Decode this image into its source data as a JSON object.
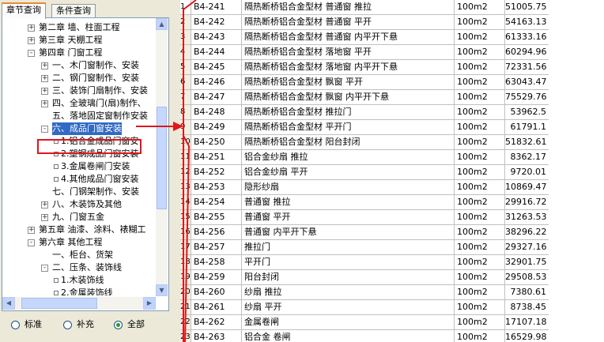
{
  "tabs": [
    {
      "label": "章节查询",
      "active": true
    },
    {
      "label": "条件查询",
      "active": false
    }
  ],
  "tree": [
    {
      "label": "第二章 墙、柱面工程",
      "expander": "+"
    },
    {
      "label": "第三章 天棚工程",
      "expander": "+"
    },
    {
      "label": "第四章 门窗工程",
      "expander": "-"
    },
    {
      "label": "一、木门窗制作、安装",
      "expander": "+"
    },
    {
      "label": "二、钢门窗制作、安装",
      "expander": "+"
    },
    {
      "label": "三、装饰门扇制作、安装",
      "expander": "+"
    },
    {
      "label": "四、全玻璃门(扇)制作、",
      "expander": "+"
    },
    {
      "label": "五、落地固定窗制作安装",
      "expander": ""
    },
    {
      "label": "六、成品门窗安装",
      "expander": "-",
      "selected": true
    },
    {
      "label": "1.铝合金成品门窗安",
      "expander": ""
    },
    {
      "label": "2.塑钢成品门窗安装",
      "expander": ""
    },
    {
      "label": "3.金属卷闸门安装",
      "expander": ""
    },
    {
      "label": "4.其他成品门窗安装",
      "expander": ""
    },
    {
      "label": "七、门钢架制作、安装",
      "expander": ""
    },
    {
      "label": "八、木装饰及其他",
      "expander": "+"
    },
    {
      "label": "九、门窗五金",
      "expander": "+"
    },
    {
      "label": "第五章 油漆、涂料、裱糊工",
      "expander": "+"
    },
    {
      "label": "第六章 其他工程",
      "expander": "-"
    },
    {
      "label": "一、柜台、货架",
      "expander": ""
    },
    {
      "label": "二、压条、装饰线",
      "expander": "-"
    },
    {
      "label": "1.木装饰线",
      "expander": ""
    },
    {
      "label": "2.金属装饰线",
      "expander": ""
    }
  ],
  "radios": [
    {
      "label": "标准",
      "checked": false
    },
    {
      "label": "补充",
      "checked": false
    },
    {
      "label": "全部",
      "checked": true
    }
  ],
  "rows": [
    {
      "no": "1",
      "code": "B4-241",
      "name": "隔热断桥铝合金型材 普通窗 推拉",
      "unit": "100m2",
      "price": "51005.75"
    },
    {
      "no": "2",
      "code": "B4-242",
      "name": "隔热断桥铝合金型材 普通窗 平开",
      "unit": "100m2",
      "price": "54163.13"
    },
    {
      "no": "3",
      "code": "B4-243",
      "name": "隔热断桥铝合金型材 普通窗 内平开下悬",
      "unit": "100m2",
      "price": "61333.16"
    },
    {
      "no": "4",
      "code": "B4-244",
      "name": "隔热断桥铝合金型材 落地窗 平开",
      "unit": "100m2",
      "price": "60294.96"
    },
    {
      "no": "5",
      "code": "B4-245",
      "name": "隔热断桥铝合金型材 落地窗 内平开下悬",
      "unit": "100m2",
      "price": "72331.56"
    },
    {
      "no": "6",
      "code": "B4-246",
      "name": "隔热断桥铝合金型材 飘窗 平开",
      "unit": "100m2",
      "price": "63043.47"
    },
    {
      "no": "7",
      "code": "B4-247",
      "name": "隔热断桥铝合金型材 飘窗 内平开下悬",
      "unit": "100m2",
      "price": "75529.76"
    },
    {
      "no": "8",
      "code": "B4-248",
      "name": "隔热断桥铝合金型材 推拉门",
      "unit": "100m2",
      "price": "53962.5"
    },
    {
      "no": "9",
      "code": "B4-249",
      "name": "隔热断桥铝合金型材 平开门",
      "unit": "100m2",
      "price": "61791.1"
    },
    {
      "no": "10",
      "code": "B4-250",
      "name": "隔热断桥铝合金型材 阳台封闭",
      "unit": "100m2",
      "price": "51832.61"
    },
    {
      "no": "11",
      "code": "B4-251",
      "name": "铝合金纱扇 推拉",
      "unit": "100m2",
      "price": "8362.17"
    },
    {
      "no": "12",
      "code": "B4-252",
      "name": "铝合金纱扇 平开",
      "unit": "100m2",
      "price": "9720.01"
    },
    {
      "no": "13",
      "code": "B4-253",
      "name": "隐形纱扇",
      "unit": "100m2",
      "price": "10869.47"
    },
    {
      "no": "14",
      "code": "B4-254",
      "name": "普通窗 推拉",
      "unit": "100m2",
      "price": "29916.72"
    },
    {
      "no": "15",
      "code": "B4-255",
      "name": "普通窗 平开",
      "unit": "100m2",
      "price": "31263.53"
    },
    {
      "no": "16",
      "code": "B4-256",
      "name": "普通窗 内平开下悬",
      "unit": "100m2",
      "price": "38296.22"
    },
    {
      "no": "17",
      "code": "B4-257",
      "name": "推拉门",
      "unit": "100m2",
      "price": "29327.16"
    },
    {
      "no": "18",
      "code": "B4-258",
      "name": "平开门",
      "unit": "100m2",
      "price": "32901.75"
    },
    {
      "no": "19",
      "code": "B4-259",
      "name": "阳台封闭",
      "unit": "100m2",
      "price": "29508.53"
    },
    {
      "no": "20",
      "code": "B4-260",
      "name": "纱扇 推拉",
      "unit": "100m2",
      "price": "7380.61"
    },
    {
      "no": "21",
      "code": "B4-261",
      "name": "纱扇 平开",
      "unit": "100m2",
      "price": "8738.45"
    },
    {
      "no": "22",
      "code": "B4-262",
      "name": "金属卷闸",
      "unit": "100m2",
      "price": "17107.18"
    },
    {
      "no": "23",
      "code": "B4-263",
      "name": "铝合金 卷闸",
      "unit": "100m2",
      "price": "16529.98"
    }
  ],
  "colors": {
    "annotation": "#e0161b",
    "selection": "#316ac5",
    "tab_accent": "#e68b2c"
  }
}
